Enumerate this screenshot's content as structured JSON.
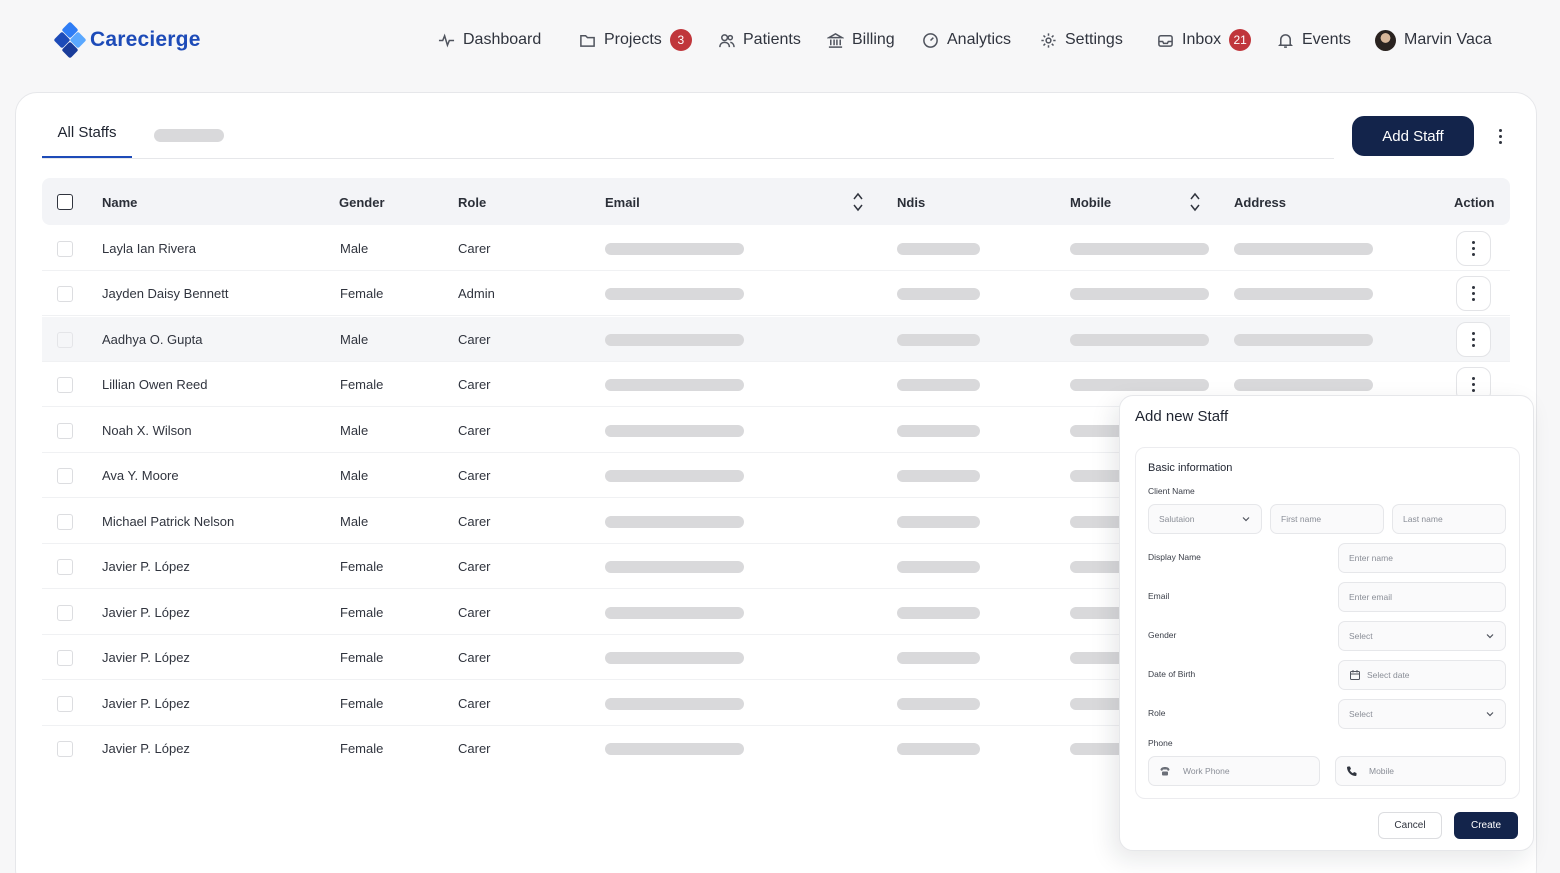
{
  "app": {
    "name": "Carecierge"
  },
  "nav": {
    "items": [
      {
        "label": "Dashboard",
        "icon": "pulse-icon"
      },
      {
        "label": "Projects",
        "icon": "folder-icon",
        "badge": "3"
      },
      {
        "label": "Patients",
        "icon": "users-icon"
      },
      {
        "label": "Billing",
        "icon": "bank-icon"
      },
      {
        "label": "Analytics",
        "icon": "gauge-icon"
      },
      {
        "label": "Settings",
        "icon": "gear-icon"
      },
      {
        "label": "Inbox",
        "icon": "inbox-icon",
        "badge": "21"
      },
      {
        "label": "Events",
        "icon": "bell-icon"
      }
    ],
    "user": {
      "name": "Marvin Vaca"
    }
  },
  "tabs": {
    "active": "All Staffs"
  },
  "toolbar": {
    "add_label": "Add Staff"
  },
  "table": {
    "headers": {
      "name": "Name",
      "gender": "Gender",
      "role": "Role",
      "email": "Email",
      "ndis": "Ndis",
      "mobile": "Mobile",
      "address": "Address",
      "action": "Action"
    },
    "rows": [
      {
        "name": "Layla Ian Rivera",
        "gender": "Male",
        "role": "Carer"
      },
      {
        "name": "Jayden Daisy Bennett",
        "gender": "Female",
        "role": "Admin"
      },
      {
        "name": "Aadhya O. Gupta",
        "gender": "Male",
        "role": "Carer"
      },
      {
        "name": "Lillian Owen Reed",
        "gender": "Female",
        "role": "Carer"
      },
      {
        "name": "Noah X. Wilson",
        "gender": "Male",
        "role": "Carer"
      },
      {
        "name": "Ava Y. Moore",
        "gender": "Male",
        "role": "Carer"
      },
      {
        "name": "Michael Patrick Nelson",
        "gender": "Male",
        "role": "Carer"
      },
      {
        "name": "Javier P. López",
        "gender": "Female",
        "role": "Carer"
      },
      {
        "name": "Javier P. López",
        "gender": "Female",
        "role": "Carer"
      },
      {
        "name": "Javier P. López",
        "gender": "Female",
        "role": "Carer"
      },
      {
        "name": "Javier P. López",
        "gender": "Female",
        "role": "Carer"
      },
      {
        "name": "Javier P. López",
        "gender": "Female",
        "role": "Carer"
      }
    ]
  },
  "panel": {
    "title": "Add new Staff",
    "section_title": "Basic information",
    "client_name_label": "Client Name",
    "salutation_placeholder": "Salutaion",
    "first_name_placeholder": "First name",
    "last_name_placeholder": "Last name",
    "display_name_label": "Display Name",
    "display_name_placeholder": "Enter name",
    "email_label": "Email",
    "email_placeholder": "Enter email",
    "gender_label": "Gender",
    "gender_placeholder": "Select",
    "dob_label": "Date of Birth",
    "dob_placeholder": "Select date",
    "role_label": "Role",
    "role_placeholder": "Select",
    "phone_label": "Phone",
    "work_phone_placeholder": "Work Phone",
    "mobile_placeholder": "Mobile",
    "cancel_label": "Cancel",
    "create_label": "Create"
  },
  "colors": {
    "brand": "#1d4bb8",
    "primary_button": "#13244b",
    "badge": "#c0363b"
  }
}
